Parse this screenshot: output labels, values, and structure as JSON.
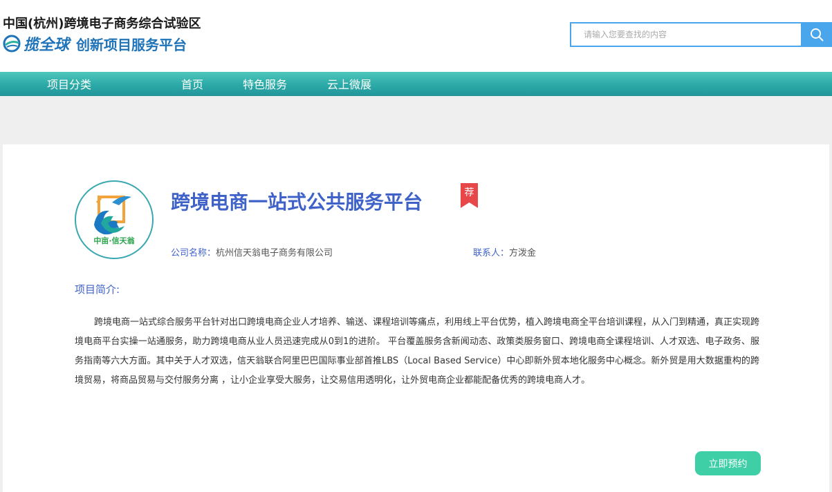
{
  "header": {
    "logo_line1": "中国(杭州)跨境电子商务综合试验区",
    "logo_brand": "揽全球",
    "logo_sub": "创新项目服务平台",
    "search_placeholder": "请输入您要查找的内容",
    "accent_color": "#49a5ec"
  },
  "nav": {
    "items": [
      {
        "label": "项目分类"
      },
      {
        "label": "首页"
      },
      {
        "label": "特色服务"
      },
      {
        "label": "云上微展"
      }
    ]
  },
  "project": {
    "title": "跨境电商一站式公共服务平台",
    "badge": "荐",
    "logo_text": "中亩·信天翁",
    "company_label": "公司名称：",
    "company_value": "杭州信天翁电子商务有限公司",
    "contact_label": "联系人：",
    "contact_value": "方泼金",
    "intro_title": "项目简介:",
    "intro_body": "跨境电商一站式综合服务平台针对出口跨境电商企业人才培养、输送、课程培训等痛点，利用线上平台优势，植入跨境电商全平台培训课程，从入门到精通，真正实现跨境电商平台实操一站通服务，助力跨境电商从业人员迅速完成从0到1的进阶。 平台覆盖服务含新闻动态、政策类服务窗口、跨境电商全课程培训、人才双选、电子政务、服务指南等六大方面。其中关于人才双选，信天翁联合阿里巴巴国际事业部首推LBS（Local Based Service）中心即新外贸本地化服务中心概念。新外贸是用大数据重构的跨境贸易，将商品贸易与交付服务分离 ，让小企业享受大服务，让交易信用透明化，让外贸电商企业都能配备优秀的跨境电商人才。",
    "book_label": "立即预约"
  },
  "colors": {
    "title_blue": "#3f62c8",
    "nav_teal": "#2ba9a7",
    "badge_red": "#e8474a",
    "button_green": "#3ecfa6"
  }
}
